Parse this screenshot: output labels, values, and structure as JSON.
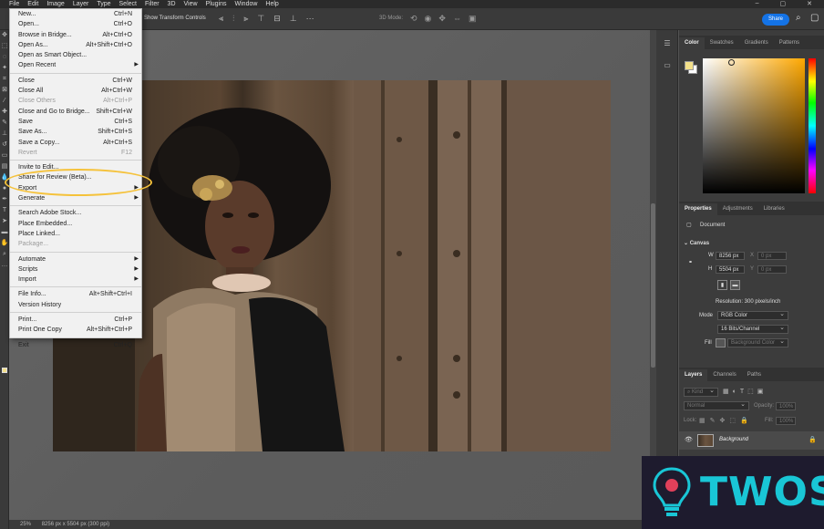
{
  "menubar": {
    "items": [
      "File",
      "Edit",
      "Image",
      "Layer",
      "Type",
      "Select",
      "Filter",
      "3D",
      "View",
      "Plugins",
      "Window",
      "Help"
    ]
  },
  "options_bar": {
    "show_transform_controls": "Show Transform Controls",
    "mode_3d": "3D Mode:",
    "share": "Share"
  },
  "file_menu": {
    "groups": [
      [
        {
          "label": "New...",
          "shortcut": "Ctrl+N"
        },
        {
          "label": "Open...",
          "shortcut": "Ctrl+O"
        },
        {
          "label": "Browse in Bridge...",
          "shortcut": "Alt+Ctrl+O"
        },
        {
          "label": "Open As...",
          "shortcut": "Alt+Shift+Ctrl+O"
        },
        {
          "label": "Open as Smart Object...",
          "shortcut": ""
        },
        {
          "label": "Open Recent",
          "shortcut": "",
          "submenu": true
        }
      ],
      [
        {
          "label": "Close",
          "shortcut": "Ctrl+W"
        },
        {
          "label": "Close All",
          "shortcut": "Alt+Ctrl+W"
        },
        {
          "label": "Close Others",
          "shortcut": "Alt+Ctrl+P",
          "disabled": true
        },
        {
          "label": "Close and Go to Bridge...",
          "shortcut": "Shift+Ctrl+W"
        },
        {
          "label": "Save",
          "shortcut": "Ctrl+S"
        },
        {
          "label": "Save As...",
          "shortcut": "Shift+Ctrl+S"
        },
        {
          "label": "Save a Copy...",
          "shortcut": "Alt+Ctrl+S"
        },
        {
          "label": "Revert",
          "shortcut": "F12",
          "disabled": true
        }
      ],
      [
        {
          "label": "Invite to Edit...",
          "shortcut": ""
        },
        {
          "label": "Share for Review (Beta)...",
          "shortcut": ""
        },
        {
          "label": "Export",
          "shortcut": "",
          "submenu": true
        },
        {
          "label": "Generate",
          "shortcut": "",
          "submenu": true
        }
      ],
      [
        {
          "label": "Search Adobe Stock...",
          "shortcut": ""
        },
        {
          "label": "Place Embedded...",
          "shortcut": ""
        },
        {
          "label": "Place Linked...",
          "shortcut": ""
        },
        {
          "label": "Package...",
          "shortcut": "",
          "disabled": true
        }
      ],
      [
        {
          "label": "Automate",
          "shortcut": "",
          "submenu": true
        },
        {
          "label": "Scripts",
          "shortcut": "",
          "submenu": true
        },
        {
          "label": "Import",
          "shortcut": "",
          "submenu": true
        }
      ],
      [
        {
          "label": "File Info...",
          "shortcut": "Alt+Shift+Ctrl+I"
        },
        {
          "label": "Version History",
          "shortcut": ""
        }
      ],
      [
        {
          "label": "Print...",
          "shortcut": "Ctrl+P"
        },
        {
          "label": "Print One Copy",
          "shortcut": "Alt+Shift+Ctrl+P"
        }
      ],
      [
        {
          "label": "Exit",
          "shortcut": "Ctrl+Q"
        }
      ]
    ]
  },
  "color_panel": {
    "tabs": [
      "Color",
      "Swatches",
      "Gradients",
      "Patterns"
    ],
    "foreground": "#f3e08a",
    "background": "#ffffff"
  },
  "properties_panel": {
    "tabs": [
      "Properties",
      "Adjustments",
      "Libraries"
    ],
    "document_label": "Document",
    "canvas_label": "Canvas",
    "width_label": "W",
    "width_value": "8256 px",
    "height_label": "H",
    "height_value": "5504 px",
    "x_label": "X",
    "x_value": "0 px",
    "y_label": "Y",
    "y_value": "0 px",
    "resolution": "Resolution: 300 pixels/inch",
    "mode_label": "Mode",
    "mode_value": "RGB Color",
    "bits_value": "16 Bits/Channel",
    "fill_label": "Fill",
    "fill_value": "Background Color"
  },
  "layers_panel": {
    "tabs": [
      "Layers",
      "Channels",
      "Paths"
    ],
    "kind_placeholder": "Kind",
    "blend_mode": "Normal",
    "opacity_label": "Opacity:",
    "opacity_value": "100%",
    "lock_label": "Lock:",
    "fill_label": "Fill:",
    "fill_value": "100%",
    "layer_name": "Background"
  },
  "status_bar": {
    "zoom": "25%",
    "doc_info": "8256 px x 5504 px (300 ppi)"
  },
  "watermark": {
    "text": "TWOS"
  },
  "colors": {
    "accent": "#1473e6",
    "highlight_ring": "#f5c23b",
    "watermark_text": "#19c6d6"
  }
}
